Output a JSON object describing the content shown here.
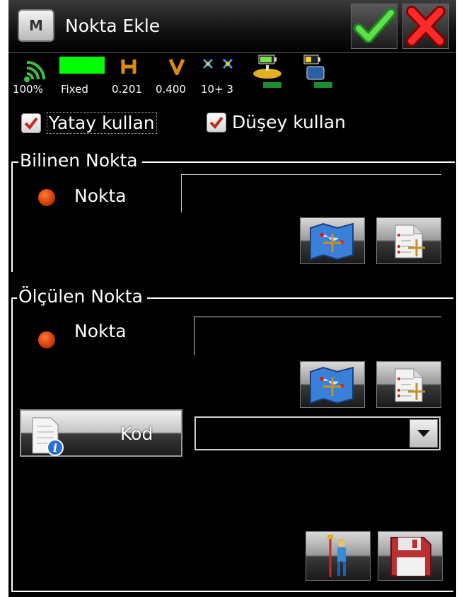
{
  "titlebar": {
    "menu_icon": "m-logo-icon",
    "title": "Nokta Ekle",
    "ok_icon": "checkmark-icon",
    "close_icon": "close-x-icon"
  },
  "status": {
    "signal": "100%",
    "solution": "Fixed",
    "h_label": "H",
    "h_value": "0.201",
    "v_label": "V",
    "v_value": "0.400",
    "satellites": "10+ 3",
    "solution_color": "#00ff00"
  },
  "options": {
    "horizontal_label": "Yatay kullan",
    "horizontal_checked": true,
    "vertical_label": "Düşey kullan",
    "vertical_checked": true
  },
  "known_point": {
    "title": "Bilinen Nokta",
    "point_label": "Nokta",
    "point_value": "",
    "map_icon": "map-icon",
    "list_icon": "point-list-icon"
  },
  "measured_point": {
    "title": "Ölçülen Nokta",
    "point_label": "Nokta",
    "point_value": "",
    "map_icon": "map-icon",
    "list_icon": "point-list-icon"
  },
  "code": {
    "button_label": "Kod",
    "button_icon": "document-info-icon",
    "selected_value": ""
  },
  "actions": {
    "survey_icon": "survey-pole-icon",
    "save_icon": "save-disk-icon"
  }
}
